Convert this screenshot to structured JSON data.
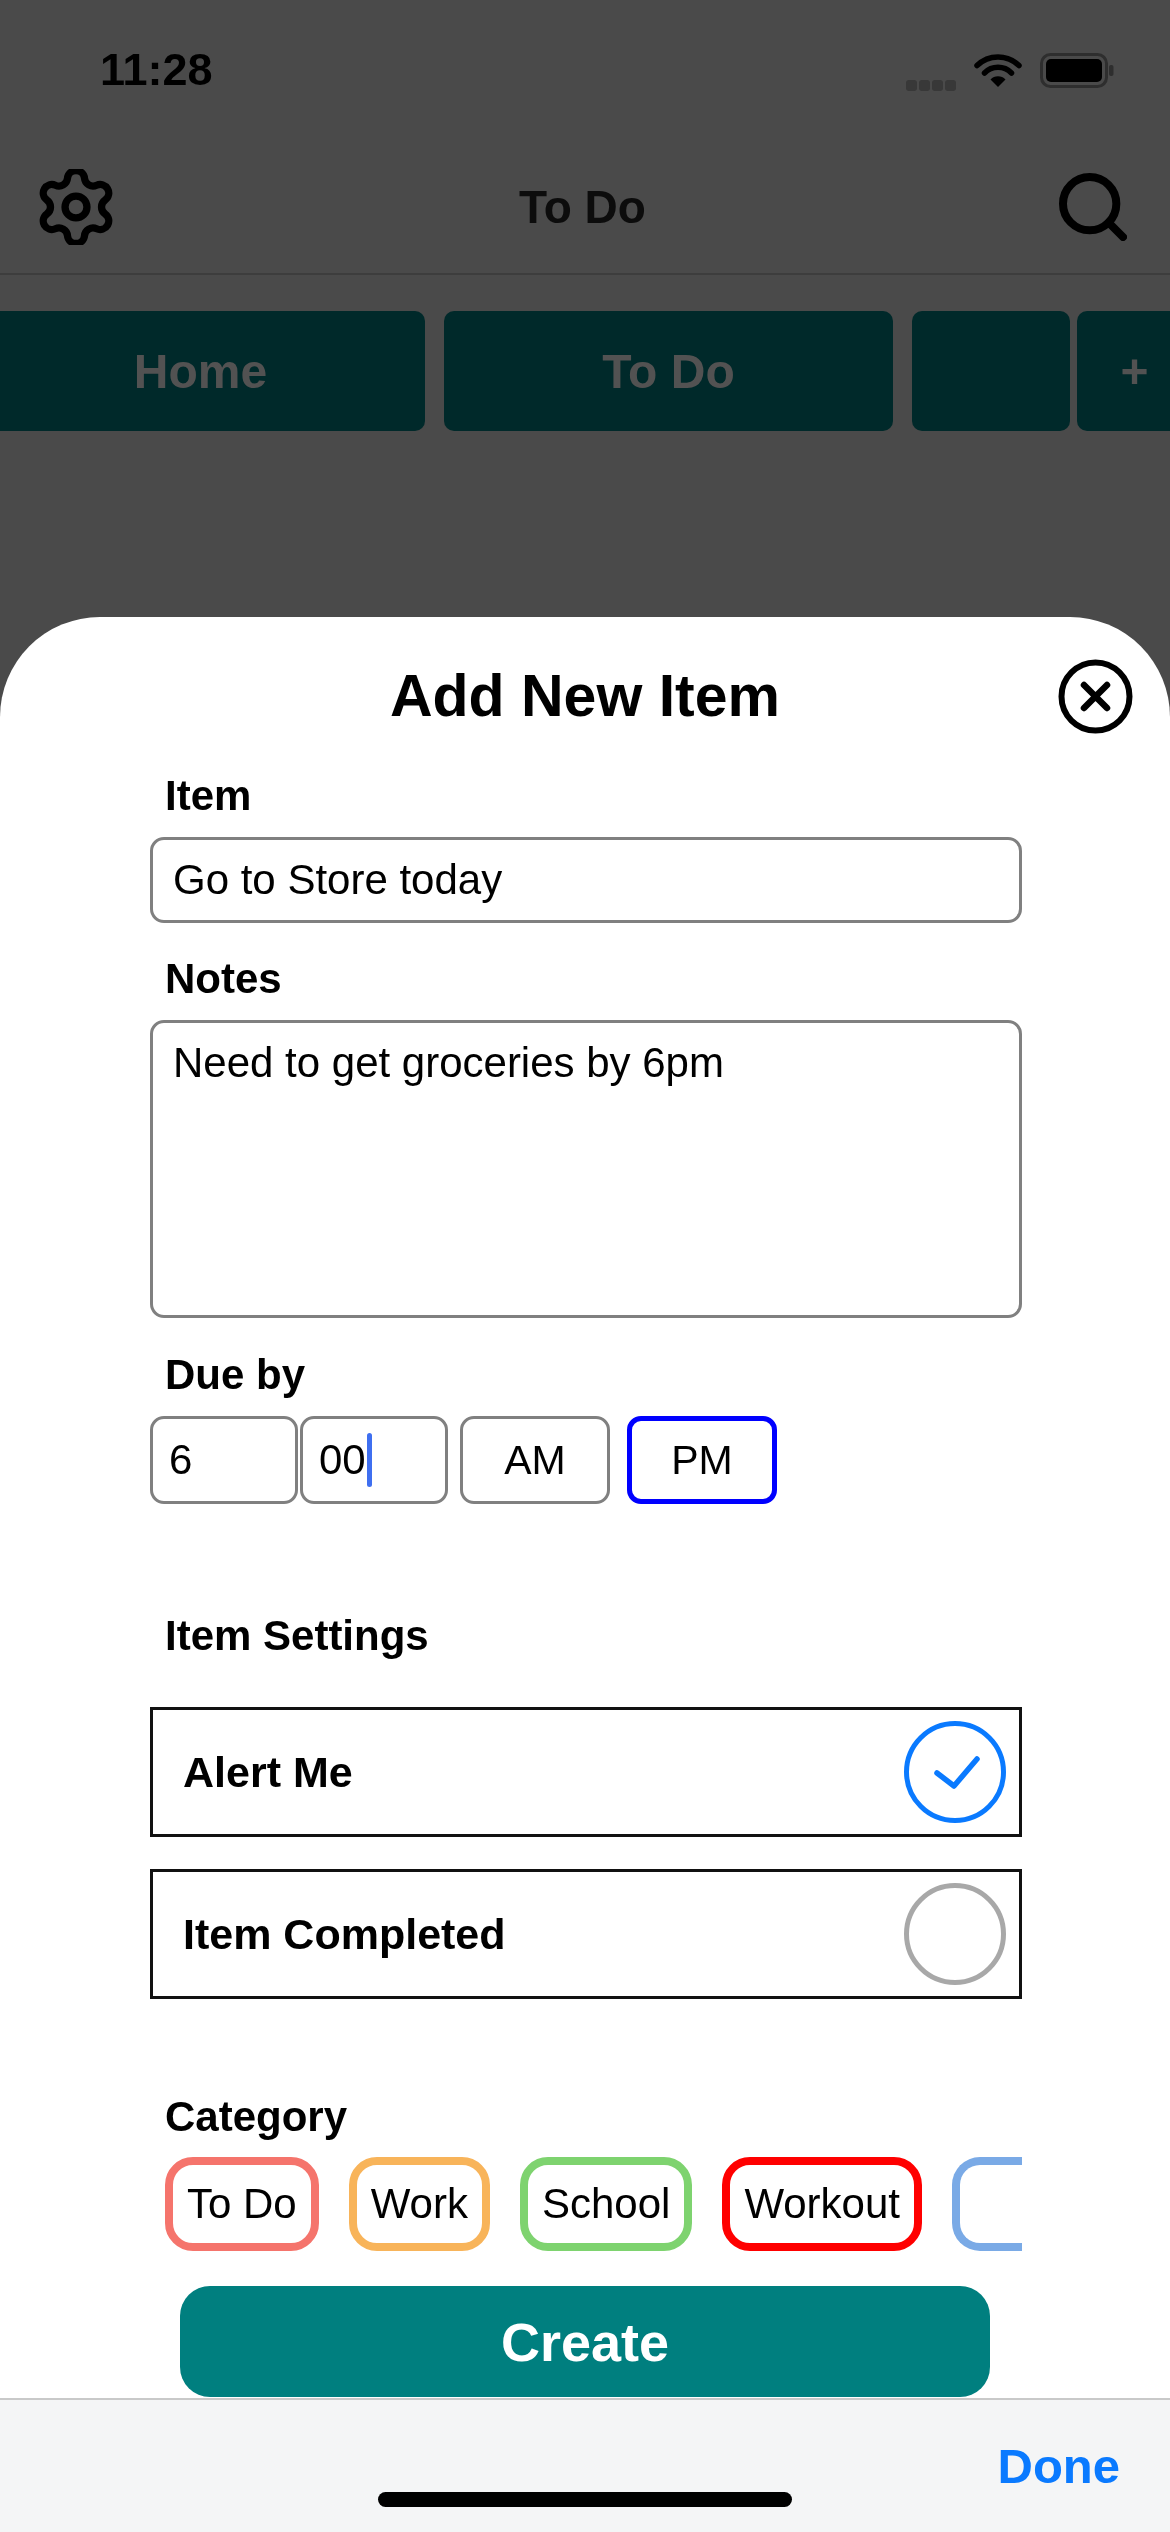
{
  "status_bar": {
    "time": "11:28"
  },
  "nav_bar": {
    "title": "To Do"
  },
  "tabs": [
    {
      "kind": "tab",
      "label": "Home"
    },
    {
      "kind": "tab",
      "label": "To Do"
    },
    {
      "kind": "covered"
    }
  ],
  "add_tab_button": "+",
  "sheet": {
    "title": "Add New Item",
    "item": {
      "label": "Item",
      "value": "Go to Store today"
    },
    "notes": {
      "label": "Notes",
      "value": "Need to get groceries by 6pm"
    },
    "due_by": {
      "label": "Due by",
      "hour": {
        "value": "6",
        "focused": false
      },
      "minute": {
        "value": "00",
        "focused": true
      },
      "periods": [
        {
          "label": "AM",
          "selected": false
        },
        {
          "label": "PM",
          "selected": true
        }
      ]
    },
    "item_settings": {
      "label": "Item Settings",
      "options": [
        {
          "label": "Alert Me",
          "checked": true
        },
        {
          "label": "Item Completed",
          "checked": false
        }
      ]
    },
    "category": {
      "label": "Category",
      "chips": [
        {
          "label": "To Do",
          "color": "#f5746c"
        },
        {
          "label": "Work",
          "color": "#f8b45a"
        },
        {
          "label": "School",
          "color": "#7ed36f"
        },
        {
          "label": "Workout",
          "color": "#ff0000"
        },
        {
          "color": "#7aaae6"
        }
      ]
    },
    "create_button": "Create"
  },
  "keyboard_toolbar": {
    "done": "Done"
  }
}
